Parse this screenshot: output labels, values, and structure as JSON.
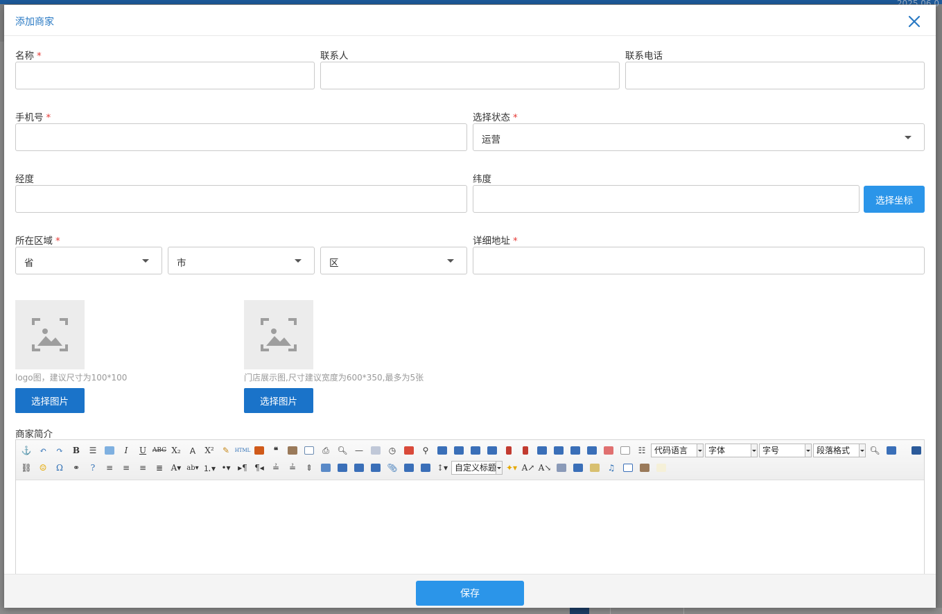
{
  "background": {
    "date_fragment": "2025 06 0"
  },
  "modal": {
    "title": "添加商家",
    "close_icon": "close-icon"
  },
  "form": {
    "name_label": "名称",
    "contact_label": "联系人",
    "phone_label": "联系电话",
    "mobile_label": "手机号",
    "status_label": "选择状态",
    "status_value": "运营",
    "longitude_label": "经度",
    "latitude_label": "纬度",
    "pick_coord_button": "选择坐标",
    "region_label": "所在区域",
    "province_value": "省",
    "city_value": "市",
    "district_value": "区",
    "address_label": "详细地址",
    "required_mark": "*",
    "logo_hint": "logo图，建议尺寸为100*100",
    "store_hint": "门店展示图,尺寸建议宽度为600*350,最多为5张",
    "pick_image_button": "选择图片",
    "intro_label": "商家简介"
  },
  "editor": {
    "combo_code_lang": "代码语言",
    "combo_font": "字体",
    "combo_size": "字号",
    "combo_paragraph": "段落格式",
    "combo_custom_title": "自定义标题"
  },
  "footer": {
    "save_button": "保存"
  },
  "colors": {
    "primary": "#2b95e9",
    "primary_dark": "#1a73c9",
    "title": "#2a7ac4",
    "required": "#e53935"
  }
}
